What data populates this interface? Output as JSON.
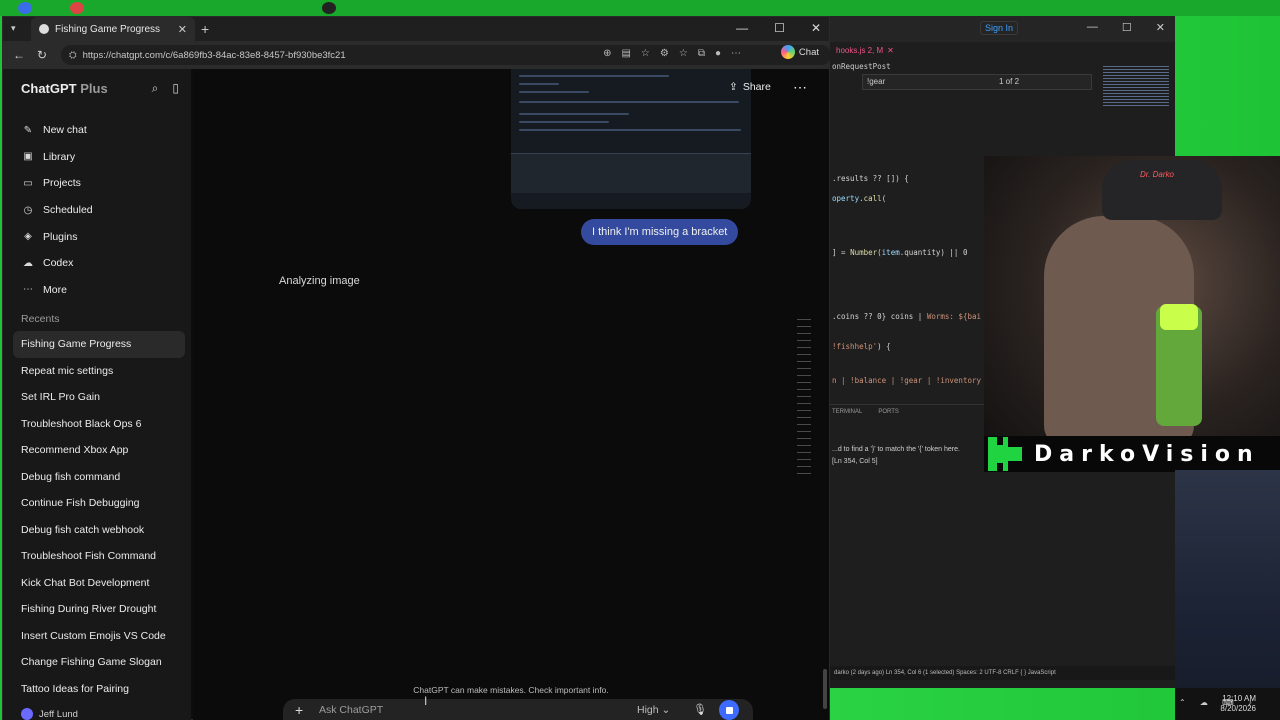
{
  "browser": {
    "tab_title": "Fishing Game Progress",
    "url": "https://chatgpt.com/c/6a869fb3-84ac-83e8-8457-bf930be3fc21",
    "chat_button": "Chat"
  },
  "sidebar": {
    "brand": "ChatGPT",
    "brand_suffix": "Plus",
    "nav": [
      {
        "label": "New chat",
        "icon": "new-chat-icon"
      },
      {
        "label": "Library",
        "icon": "library-icon"
      },
      {
        "label": "Projects",
        "icon": "projects-icon"
      },
      {
        "label": "Scheduled",
        "icon": "scheduled-icon"
      },
      {
        "label": "Plugins",
        "icon": "plugins-icon"
      },
      {
        "label": "Codex",
        "icon": "codex-icon"
      },
      {
        "label": "More",
        "icon": "more-icon"
      }
    ],
    "recents_heading": "Recents",
    "recents": [
      "Fishing Game Progress",
      "Repeat mic settings",
      "Set IRL Pro Gain",
      "Troubleshoot Black Ops 6",
      "Recommend Xbox App",
      "Debug fish command",
      "Continue Fish Debugging",
      "Debug fish catch webhook",
      "Troubleshoot Fish Command",
      "Kick Chat Bot Development",
      "Fishing During River Drought",
      "Insert Custom Emojis VS Code",
      "Change Fishing Game Slogan",
      "Tattoo Ideas for Pairing"
    ],
    "user": "Jeff Lund"
  },
  "chat": {
    "share_label": "Share",
    "user_message": "I think I'm missing a bracket",
    "status": "Analyzing image",
    "disclaimer": "ChatGPT can make mistakes. Check important info.",
    "composer_placeholder": "Ask ChatGPT",
    "mode": "High"
  },
  "vscode": {
    "sign_in": "Sign In",
    "tab": "hooks.js 2, M",
    "breadcrumb": "onRequestPost",
    "find_value": "!gear",
    "find_count": "1 of 2",
    "panel_tabs": [
      "TERMINAL",
      "PORTS"
    ],
    "problem_text": "...d to find a '}' to match the '{' token here.",
    "problem_loc": "[Ln 354, Col 5]",
    "status": "darko (2 days ago)  Ln 354, Col 6 (1 selected)  Spaces: 2  UTF-8  CRLF  { } JavaScript"
  },
  "overlay": {
    "brand_name": "DarkoVision",
    "hat_text": "Dr. Darko"
  },
  "tray": {
    "time": "12:10 AM",
    "date": "8/20/2026"
  }
}
